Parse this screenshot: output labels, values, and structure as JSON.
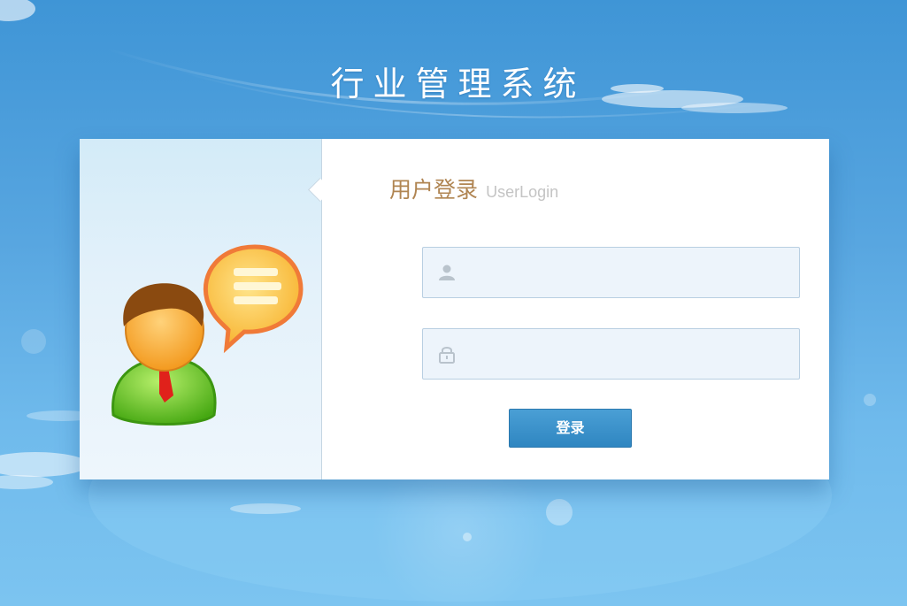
{
  "header": {
    "title": "行业管理系统"
  },
  "login": {
    "heading": "用户登录",
    "heading_en": "UserLogin",
    "username": {
      "value": "",
      "placeholder": "",
      "icon": "user-icon"
    },
    "password": {
      "value": "",
      "placeholder": "",
      "icon": "lock-icon"
    },
    "submit_label": "登录"
  },
  "colors": {
    "sky": "#58a6e0",
    "heading_accent": "#b08552",
    "button": "#3a92cb",
    "field_bg": "#edf4fb"
  }
}
